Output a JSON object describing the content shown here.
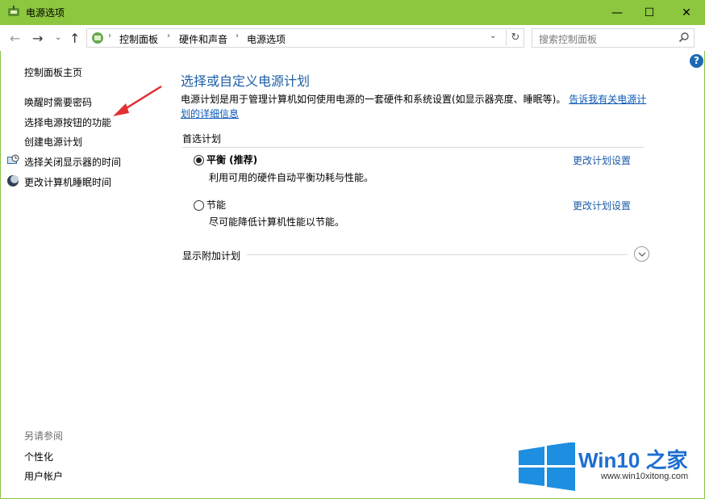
{
  "window": {
    "title": "电源选项",
    "controls": {
      "minimize": "—",
      "maximize": "☐",
      "close": "✕"
    }
  },
  "nav": {
    "back": "←",
    "forward": "→",
    "recent": "⌄",
    "up": "↑",
    "breadcrumb": [
      "控制面板",
      "硬件和声音",
      "电源选项"
    ],
    "refresh": "↻",
    "search_placeholder": "搜索控制面板",
    "help": "?"
  },
  "sidebar": {
    "home": "控制面板主页",
    "items": [
      {
        "label": "唤醒时需要密码",
        "icon": null
      },
      {
        "label": "选择电源按钮的功能",
        "icon": null
      },
      {
        "label": "创建电源计划",
        "icon": null
      },
      {
        "label": "选择关闭显示器的时间",
        "icon": "monitor-clock-icon"
      },
      {
        "label": "更改计算机睡眠时间",
        "icon": "moon-icon"
      }
    ],
    "see_also": {
      "title": "另请参阅",
      "items": [
        "个性化",
        "用户帐户"
      ]
    }
  },
  "main": {
    "title": "选择或自定义电源计划",
    "description": "电源计划是用于管理计算机如何使用电源的一套硬件和系统设置(如显示器亮度、睡眠等)。",
    "learn_more_line1": "告诉我有关电源计",
    "learn_more_line2": "划的详细信息",
    "preferred_label": "首选计划",
    "plans": [
      {
        "name": "平衡 (推荐)",
        "description": "利用可用的硬件自动平衡功耗与性能。",
        "selected": true,
        "link": "更改计划设置"
      },
      {
        "name": "节能",
        "description": "尽可能降低计算机性能以节能。",
        "selected": false,
        "link": "更改计划设置"
      }
    ],
    "show_more": "显示附加计划"
  },
  "watermark": {
    "brand": "Win10 之家",
    "url": "www.win10xitong.com"
  },
  "colors": {
    "titlebar": "#8dc63f",
    "link": "#1c5ba8",
    "heading": "#1e5fa8",
    "annotation_arrow": "#e03030"
  }
}
